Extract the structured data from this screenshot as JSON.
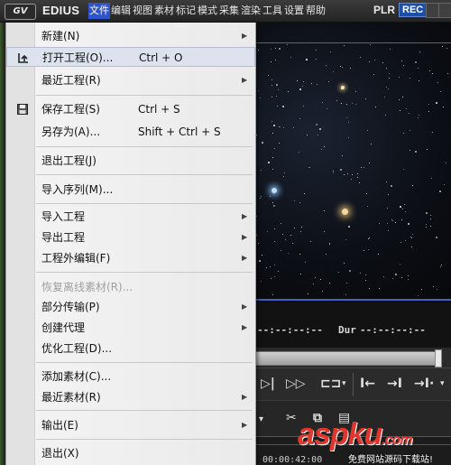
{
  "titlebar": {
    "logo_text": "GV",
    "app_name": "EDIUS",
    "menus": [
      "文件",
      "编辑",
      "视图",
      "素材",
      "标记",
      "模式",
      "采集",
      "渲染",
      "工具",
      "设置",
      "帮助"
    ],
    "active_menu": "文件",
    "plr": "PLR",
    "rec": "REC"
  },
  "file_menu": {
    "items": [
      {
        "label": "新建(N)",
        "shortcut": "",
        "submenu": true,
        "icon": ""
      },
      {
        "label": "打开工程(O)...",
        "shortcut": "Ctrl + O",
        "submenu": false,
        "icon": "open-project-icon",
        "highlighted": true
      },
      {
        "label": "最近工程(R)",
        "shortcut": "",
        "submenu": true,
        "icon": ""
      },
      {
        "label": "保存工程(S)",
        "shortcut": "Ctrl + S",
        "submenu": false,
        "icon": "save-disk-icon"
      },
      {
        "label": "另存为(A)...",
        "shortcut": "Shift + Ctrl + S",
        "submenu": false,
        "icon": ""
      },
      {
        "label": "退出工程(J)",
        "shortcut": "",
        "submenu": false,
        "icon": ""
      },
      {
        "label": "导入序列(M)...",
        "shortcut": "",
        "submenu": false,
        "icon": ""
      },
      {
        "label": "导入工程",
        "shortcut": "",
        "submenu": true,
        "icon": ""
      },
      {
        "label": "导出工程",
        "shortcut": "",
        "submenu": true,
        "icon": ""
      },
      {
        "label": "工程外编辑(F)",
        "shortcut": "",
        "submenu": true,
        "icon": ""
      },
      {
        "label": "恢复离线素材(R)...",
        "shortcut": "",
        "submenu": false,
        "icon": "",
        "disabled": true
      },
      {
        "label": "部分传输(P)",
        "shortcut": "",
        "submenu": true,
        "icon": ""
      },
      {
        "label": "创建代理",
        "shortcut": "",
        "submenu": true,
        "icon": ""
      },
      {
        "label": "优化工程(D)...",
        "shortcut": "",
        "submenu": false,
        "icon": ""
      },
      {
        "label": "添加素材(C)...",
        "shortcut": "",
        "submenu": false,
        "icon": ""
      },
      {
        "label": "最近素材(R)",
        "shortcut": "",
        "submenu": true,
        "icon": ""
      },
      {
        "label": "输出(E)",
        "shortcut": "",
        "submenu": true,
        "icon": ""
      },
      {
        "label": "退出(X)",
        "shortcut": "",
        "submenu": false,
        "icon": ""
      }
    ]
  },
  "player": {
    "timecode_in": "--:--:--:--",
    "dur_label": "Dur",
    "timecode_dur": "--:--:--:--"
  },
  "timeline": {
    "timecode": "00:00:42:00"
  },
  "watermark": {
    "brand": "aspku",
    "domain_suffix": ".com",
    "subtitle": "免费网站源码下载站!"
  },
  "colors": {
    "menu_highlight": "#dde3ee",
    "active_menu_bg": "#2f55c8",
    "rec_bg": "#1f4ea8",
    "preview_border": "#3c63c6"
  }
}
